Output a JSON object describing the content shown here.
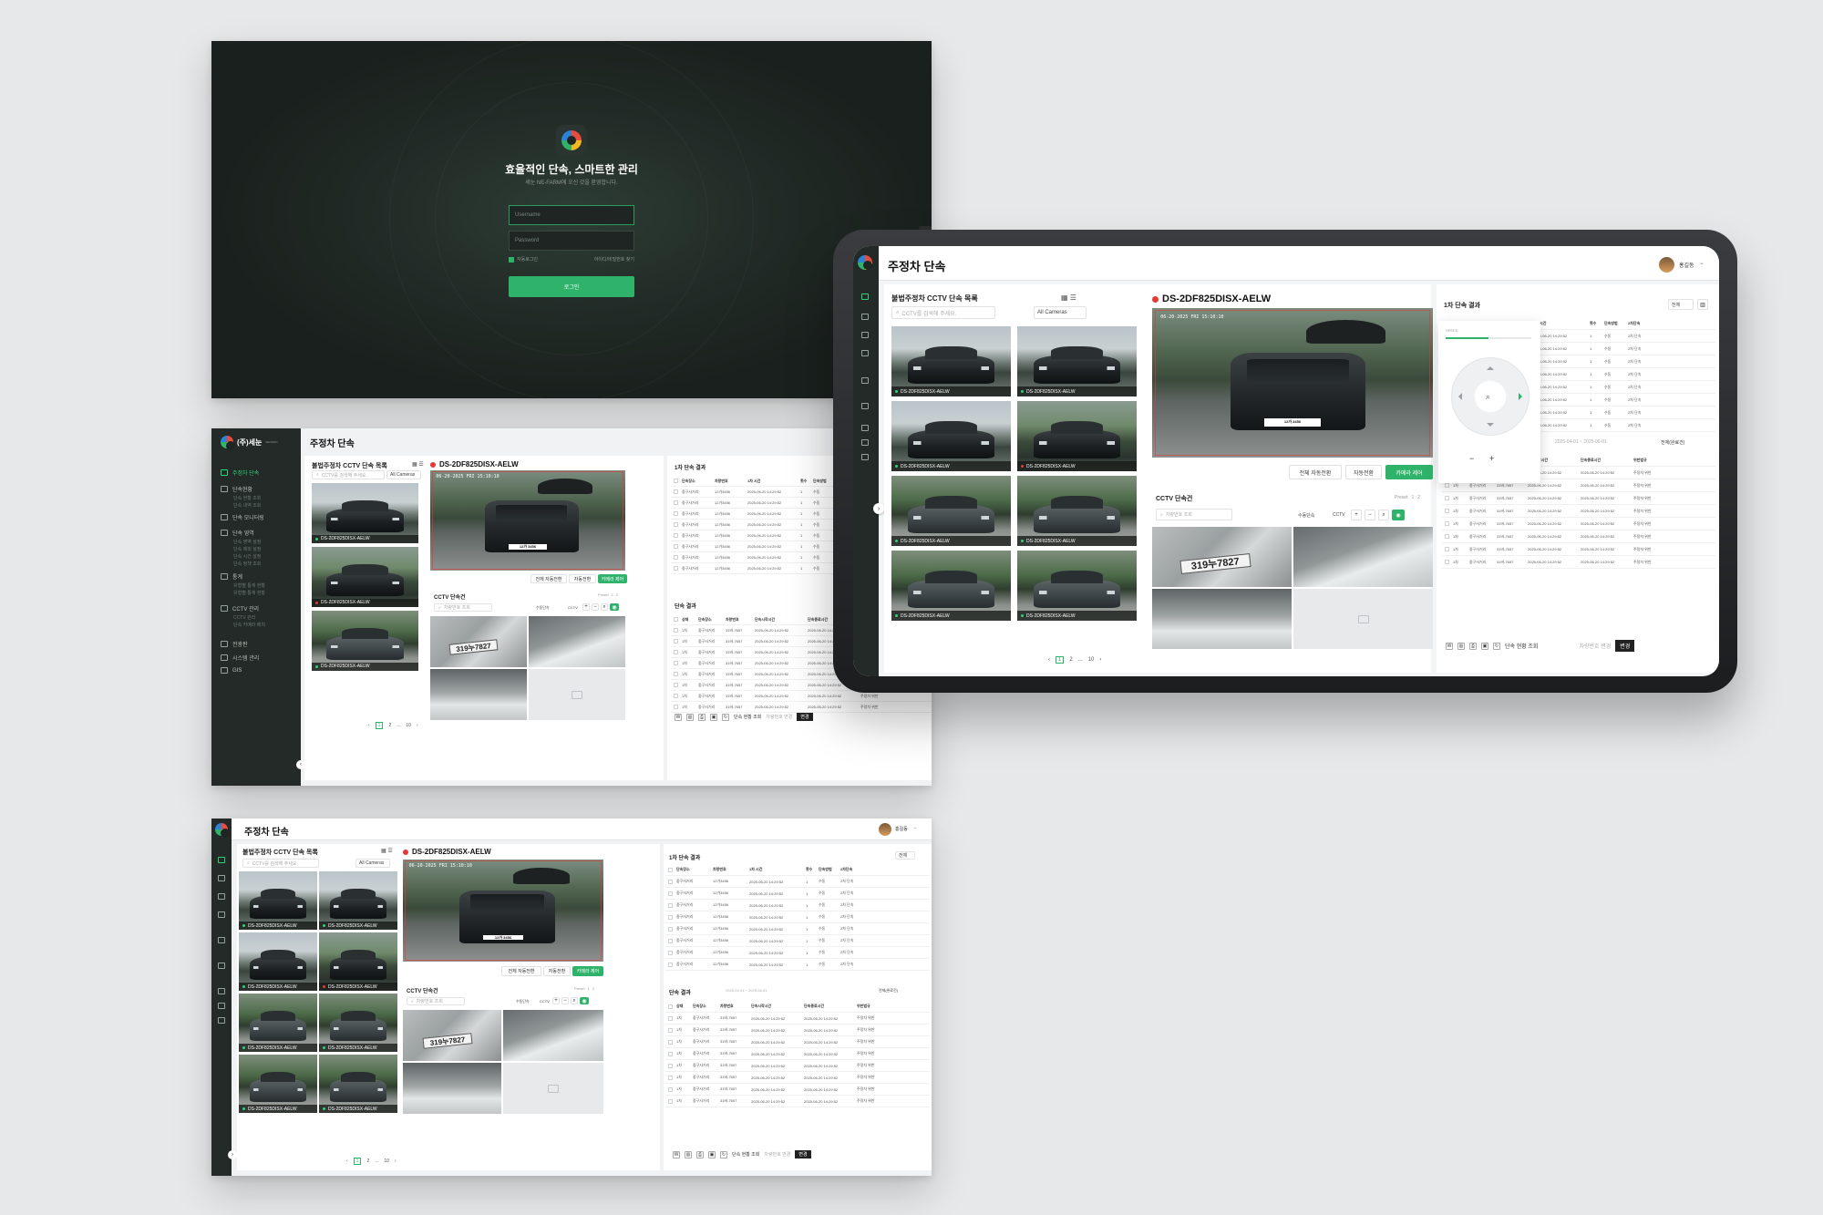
{
  "login": {
    "title": "효율적인 단속, 스마트한 관리",
    "subtitle": "세눈 NE-FARM에 오신 것을 환영합니다.",
    "username_placeholder": "Username",
    "password_placeholder": "Password",
    "remember_label": "자동로그인",
    "find_label": "아이디/비밀번호 찾기",
    "login_button": "로그인"
  },
  "brand": {
    "company": "(주)세눈",
    "company_sub": "SENOON"
  },
  "colors": {
    "accent": "#2fb36b",
    "alert": "#e53935",
    "sidebar": "#232a27"
  },
  "page": {
    "title": "주정차 단속"
  },
  "user": {
    "name": "홍길동"
  },
  "sidebar": {
    "items": [
      {
        "label": "주정차 단속",
        "icon": "car-icon",
        "active": true
      },
      {
        "label": "단속현황",
        "icon": "status-icon",
        "subs": [
          "단속 현황 조회",
          "단속 내역 조회"
        ]
      },
      {
        "label": "단속 모니터링",
        "icon": "monitor-icon"
      },
      {
        "label": "단속 영역",
        "icon": "area-icon",
        "subs": [
          "단속 영역 설정",
          "단속 제외 설정",
          "단속 시간 설정",
          "단속 정책 조회"
        ]
      },
      {
        "label": "통계",
        "icon": "chart-icon",
        "subs": [
          "유형별 통계 현황",
          "유형별 통계 현황"
        ]
      },
      {
        "label": "CCTV 관리",
        "icon": "cctv-icon",
        "subs": [
          "CCTV 관리",
          "단속 카메라 배치"
        ]
      },
      {
        "label": "전광판",
        "icon": "display-icon"
      },
      {
        "label": "시스템 관리",
        "icon": "system-icon"
      },
      {
        "label": "GIS",
        "icon": "gis-icon"
      }
    ]
  },
  "cctv_list": {
    "title": "불법주정차 CCTV 단속 목록",
    "search_placeholder": "CCTV를 검색해 주세요.",
    "filter": "All Cameras",
    "camera_label": "DS-2DF825DISX-AELW",
    "pages": [
      "1",
      "2",
      "...",
      "10"
    ]
  },
  "camera": {
    "name": "DS-2DF825DISX-AELW",
    "timestamp": "06-20-2025 FRI 15:10:10",
    "plate": "12가 3456",
    "btn_auto_all": "전체 자동전환",
    "btn_auto": "자동전환",
    "btn_control": "카메라 제어"
  },
  "cctv_capture": {
    "title": "CCTV 단속건",
    "preset_label": "Preset",
    "preset_values": [
      "1",
      "2"
    ],
    "search_placeholder": "차량번호 조회",
    "manual_label": "수동단속",
    "cctv_label": "CCTV",
    "plate_text": "319누7827"
  },
  "first_result": {
    "title": "1차 단속 결과",
    "filter": "전체",
    "headers": [
      "단속장소",
      "차량번호",
      "1차 시간",
      "횟수",
      "단속방법",
      "2차단속"
    ],
    "rows": [
      [
        "중구사거리",
        "12가3456",
        "2025-06-20 14:29:52",
        "1",
        "수동",
        "2차 단속"
      ],
      [
        "중구사거리",
        "12가3456",
        "2025-06-20 14:29:52",
        "1",
        "수동",
        "2차 단속"
      ],
      [
        "중구사거리",
        "12가3456",
        "2025-06-20 14:29:52",
        "1",
        "수동",
        "2차 단속"
      ],
      [
        "중구사거리",
        "12가3456",
        "2025-06-20 14:29:52",
        "1",
        "수동",
        "2차 단속"
      ],
      [
        "중구사거리",
        "12가3456",
        "2025-06-20 14:29:52",
        "1",
        "수동",
        "2차 단속"
      ],
      [
        "중구사거리",
        "12가3456",
        "2025-06-20 14:29:52",
        "1",
        "수동",
        "2차 단속"
      ],
      [
        "중구사거리",
        "12가3456",
        "2025-06-20 14:29:52",
        "1",
        "수동",
        "2차 단속"
      ],
      [
        "중구사거리",
        "12가3456",
        "2025-06-20 14:29:52",
        "1",
        "수동",
        "2차 단속"
      ]
    ]
  },
  "result": {
    "title": "단속 결과",
    "date_range": "2025-04-01 ~ 2025-06-01",
    "filter": "전체(완료건)",
    "headers": [
      "상태",
      "단속장소",
      "차량번호",
      "단속시작시간",
      "단속종료시간",
      "위반법규"
    ],
    "rows": [
      [
        "1차",
        "중구사거리",
        "31바-7657",
        "2025-06-20 14:29:52",
        "2025-06-20 14:29:52",
        "주정차 위반"
      ],
      [
        "1차",
        "중구사거리",
        "31바-7657",
        "2025-06-20 14:29:52",
        "2025-06-20 14:29:52",
        "주정차 위반"
      ],
      [
        "1차",
        "중구사거리",
        "31바-7657",
        "2025-06-20 14:29:52",
        "2025-06-20 14:29:52",
        "주정차 위반"
      ],
      [
        "1차",
        "중구사거리",
        "31바-7657",
        "2025-06-20 14:29:52",
        "2025-06-20 14:29:52",
        "주정차 위반"
      ],
      [
        "1차",
        "중구사거리",
        "31바-7657",
        "2025-06-20 14:29:52",
        "2025-06-20 14:29:52",
        "주정차 위반"
      ],
      [
        "1차",
        "중구사거리",
        "31바-7657",
        "2025-06-20 14:29:52",
        "2025-06-20 14:29:52",
        "주정차 위반"
      ],
      [
        "1차",
        "중구사거리",
        "31바-7657",
        "2025-06-20 14:29:52",
        "2025-06-20 14:29:52",
        "주정차 위반"
      ],
      [
        "1차",
        "중구사거리",
        "31바-7657",
        "2025-06-20 14:29:52",
        "2025-06-20 14:29:52",
        "주정차 위반"
      ]
    ],
    "bottom_query": "단속 현황 조회",
    "bottom_placeholder": "차량번호 변경",
    "bottom_change": "변경"
  },
  "ptz": {
    "speed_label": "SPEED",
    "speed_level": 0.5,
    "zoom_minus": "−",
    "zoom_plus": "+"
  }
}
